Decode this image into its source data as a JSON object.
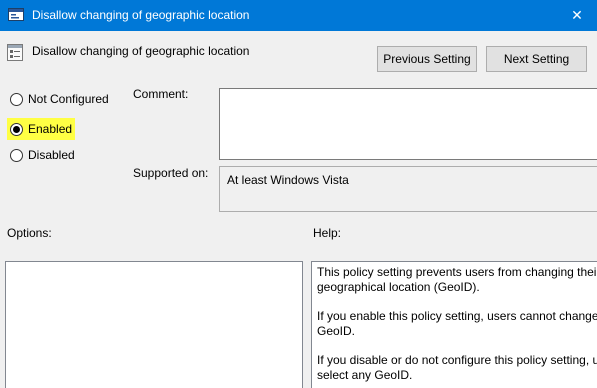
{
  "window": {
    "title": "Disallow changing of geographic location",
    "close_glyph": "✕"
  },
  "header": {
    "policy_name": "Disallow changing of geographic location",
    "previous_label": "Previous Setting",
    "next_label": "Next Setting"
  },
  "state": {
    "options": [
      {
        "label": "Not Configured",
        "selected": false
      },
      {
        "label": "Enabled",
        "selected": true,
        "highlight": "#ffff44"
      },
      {
        "label": "Disabled",
        "selected": false
      }
    ]
  },
  "comment": {
    "label": "Comment:",
    "value": ""
  },
  "supported": {
    "label": "Supported on:",
    "value": "At least Windows Vista"
  },
  "options_pane": {
    "label": "Options:"
  },
  "help_pane": {
    "label": "Help:",
    "lines": [
      "This policy setting prevents users from changing their",
      "geographical location (GeoID).",
      "If you enable this policy setting, users cannot change their",
      "GeoID.",
      "If you disable or do not configure this policy setting, users can",
      "select any GeoID."
    ]
  },
  "colors": {
    "titlebar": "#0078d7",
    "window_bg": "#f0f0f0",
    "highlight": "#ffff44"
  },
  "icons": [
    "policy-window-icon",
    "policy-setting-icon",
    "close-icon"
  ]
}
